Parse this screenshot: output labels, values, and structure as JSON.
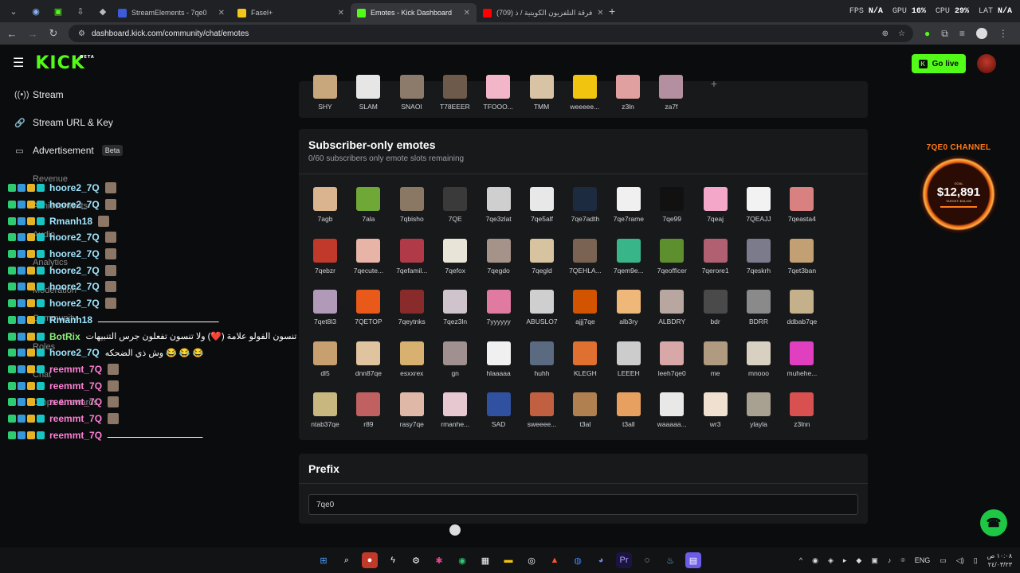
{
  "browser": {
    "tabs": [
      {
        "label": "StreamElements - 7qe0",
        "favicon_color": "#3b5bdb",
        "active": false
      },
      {
        "label": "Fasel+",
        "favicon_color": "#f5c518",
        "active": false
      },
      {
        "label": "Emotes - Kick Dashboard",
        "favicon_color": "#53fc18",
        "active": true
      },
      {
        "label": "(709) فرقة التلفزيون الكويتية / ذ",
        "favicon_color": "#ff0000",
        "active": false
      }
    ],
    "url": "dashboard.kick.com/community/chat/emotes",
    "stats": {
      "fps_label": "FPS",
      "fps_value": "N/A",
      "gpu_label": "GPU",
      "gpu_value": "16%",
      "cpu_label": "CPU",
      "cpu_value": "29%",
      "lat_label": "LAT",
      "lat_value": "N/A"
    }
  },
  "header": {
    "logo": "KICK",
    "logo_badge": "BETA",
    "go_live": "Go live"
  },
  "sidebar": {
    "items": [
      {
        "label": "Stream",
        "icon": "broadcast-icon"
      },
      {
        "label": "Stream URL & Key",
        "icon": "link-icon"
      },
      {
        "label": "Advertisement",
        "icon": "ad-icon",
        "badge": "Beta"
      }
    ],
    "hidden_items": [
      "Revenue",
      "Achievements",
      "Audio",
      "Analytics",
      "Moderation",
      "Community",
      "Roles",
      "Chat",
      "Drops & rewards"
    ]
  },
  "chat_overlay": [
    {
      "user": "hoore2_7Q",
      "msg": "",
      "style": "cyan"
    },
    {
      "user": "hoore2_7Q",
      "msg": "",
      "style": "cyan"
    },
    {
      "user": "Rmanh18",
      "msg": "",
      "style": "cyan"
    },
    {
      "user": "hoore2_7Q",
      "msg": "",
      "style": "cyan"
    },
    {
      "user": "hoore2_7Q",
      "msg": "",
      "style": "cyan"
    },
    {
      "user": "hoore2_7Q",
      "msg": "",
      "style": "cyan"
    },
    {
      "user": "hoore2_7Q",
      "msg": "",
      "style": "cyan"
    },
    {
      "user": "hoore2_7Q",
      "msg": "",
      "style": "cyan"
    },
    {
      "user": "Rmanh18",
      "msg": "ـــــــــــــــــــــــــــــــــــــــــــــــ",
      "style": "cyan"
    },
    {
      "user": "BotRix",
      "msg": "ورين جميعًا لا تنسون الفولو علامة (❤️) ولا تنسون تفعلون جرس التنبيهات",
      "style": "bot"
    },
    {
      "user": "hoore2_7Q",
      "msg": "وش ذي الضحكه 😂 😂 😂",
      "style": "cyan"
    },
    {
      "user": "reemmt_7Q",
      "msg": "",
      "style": "pink"
    },
    {
      "user": "reemmt_7Q",
      "msg": "",
      "style": "pink"
    },
    {
      "user": "reemmt_7Q",
      "msg": "",
      "style": "pink"
    },
    {
      "user": "reemmt_7Q",
      "msg": "",
      "style": "pink"
    },
    {
      "user": "reemmt_7Q",
      "msg": "ـــــــــــــــــــــــــــــــــــــ",
      "style": "pink"
    }
  ],
  "top_emotes": [
    {
      "name": "SHY",
      "color": "#c9a77c"
    },
    {
      "name": "SLAM",
      "color": "#e6e6e6"
    },
    {
      "name": "SNAOI",
      "color": "#8c7a6b"
    },
    {
      "name": "T78EEER",
      "color": "#6d5a4a"
    },
    {
      "name": "TFOOO...",
      "color": "#f2b6c8"
    },
    {
      "name": "TMM",
      "color": "#d9c3a5"
    },
    {
      "name": "weeeee...",
      "color": "#f1c40f"
    },
    {
      "name": "z3ln",
      "color": "#e0a0a0"
    },
    {
      "name": "za7f",
      "color": "#b38fa0"
    }
  ],
  "subscriber": {
    "title": "Subscriber-only emotes",
    "subtitle": "0/60 subscribers only emote slots remaining",
    "emotes": [
      {
        "name": "7agb",
        "color": "#d9b48f"
      },
      {
        "name": "7ala",
        "color": "#6fa836"
      },
      {
        "name": "7qbisho",
        "color": "#8a7764"
      },
      {
        "name": "7QE",
        "color": "#3a3a3a"
      },
      {
        "name": "7qe3zlat",
        "color": "#cfcfcf"
      },
      {
        "name": "7qe5alf",
        "color": "#e8e8e8"
      },
      {
        "name": "7qe7adth",
        "color": "#1c2b3f"
      },
      {
        "name": "7qe7rame",
        "color": "#f0f0f0"
      },
      {
        "name": "7qe99",
        "color": "#111111"
      },
      {
        "name": "7qeaj",
        "color": "#f4a7c8"
      },
      {
        "name": "7QEAJJ",
        "color": "#f2f2f2"
      },
      {
        "name": "7qeasta4",
        "color": "#d98080"
      },
      {
        "name": "7qebzr",
        "color": "#c0392b"
      },
      {
        "name": "7qecute...",
        "color": "#e8b4a8"
      },
      {
        "name": "7qefamil...",
        "color": "#b03a48"
      },
      {
        "name": "7qefox",
        "color": "#e8e4d8"
      },
      {
        "name": "7qegdo",
        "color": "#a5938a"
      },
      {
        "name": "7qegld",
        "color": "#d8c3a0"
      },
      {
        "name": "7QEHLA...",
        "color": "#7a6352"
      },
      {
        "name": "7qem9e...",
        "color": "#39b58a"
      },
      {
        "name": "7qeofficer",
        "color": "#5d8f2e"
      },
      {
        "name": "7qerore1",
        "color": "#b06070"
      },
      {
        "name": "7qeskrh",
        "color": "#7b7b8c"
      },
      {
        "name": "7qet3ban",
        "color": "#c2a073"
      },
      {
        "name": "7qet8l3",
        "color": "#b09ab8"
      },
      {
        "name": "7QETOP",
        "color": "#e8591a"
      },
      {
        "name": "7qeytnks",
        "color": "#8a2b2b"
      },
      {
        "name": "7qez3ln",
        "color": "#d0c4cc"
      },
      {
        "name": "7yyyyyy",
        "color": "#e07aa0"
      },
      {
        "name": "ABUSLO7",
        "color": "#cfcfcf"
      },
      {
        "name": "ajjj7qe",
        "color": "#d35400"
      },
      {
        "name": "alb3ry",
        "color": "#f0b878"
      },
      {
        "name": "ALBDRY",
        "color": "#b8a7a0"
      },
      {
        "name": "bdr",
        "color": "#4a4a4a"
      },
      {
        "name": "BDRR",
        "color": "#8a8a8a"
      },
      {
        "name": "ddbab7qe",
        "color": "#c4b08a"
      },
      {
        "name": "dl5",
        "color": "#c8a070"
      },
      {
        "name": "dnn87qe",
        "color": "#e0c4a0"
      },
      {
        "name": "esxxrex",
        "color": "#d8b070"
      },
      {
        "name": "gn",
        "color": "#a09090"
      },
      {
        "name": "hlaaaaa",
        "color": "#f0f0f0"
      },
      {
        "name": "huhh",
        "color": "#5a6a80"
      },
      {
        "name": "KLEGH",
        "color": "#e07030"
      },
      {
        "name": "LEEEH",
        "color": "#cccccc"
      },
      {
        "name": "leeh7qe0",
        "color": "#d8a8a8"
      },
      {
        "name": "me",
        "color": "#b09a80"
      },
      {
        "name": "mnooo",
        "color": "#d8d0c0"
      },
      {
        "name": "muhehe...",
        "color": "#e040c0"
      },
      {
        "name": "ntab37qe",
        "color": "#c8b880"
      },
      {
        "name": "r89",
        "color": "#c06060"
      },
      {
        "name": "rasy7qe",
        "color": "#e0b8a8"
      },
      {
        "name": "rmanhe...",
        "color": "#e8c8d0"
      },
      {
        "name": "SAD",
        "color": "#3050a0"
      },
      {
        "name": "sweeee...",
        "color": "#c06040"
      },
      {
        "name": "t3al",
        "color": "#b08050"
      },
      {
        "name": "t3all",
        "color": "#e8a060"
      },
      {
        "name": "waaaaa...",
        "color": "#e8e8e8"
      },
      {
        "name": "wr3",
        "color": "#f0e0d0"
      },
      {
        "name": "ylayla",
        "color": "#a8a090"
      },
      {
        "name": "z3lnn",
        "color": "#d85050"
      }
    ]
  },
  "prefix": {
    "title": "Prefix",
    "value": "7qe0"
  },
  "goal_widget": {
    "title": "7QE0 CHANNEL",
    "label": "GOAL",
    "amount": "$12,891",
    "target": "TARGET: $15,000"
  },
  "taskbar": {
    "lang": "ENG",
    "time": "١٠:٠٨ ص",
    "date": "٢٤/٠٣/٢٣"
  },
  "colors": {
    "accent": "#53fc18",
    "card": "#18191b",
    "bg": "#0b0c0d"
  }
}
